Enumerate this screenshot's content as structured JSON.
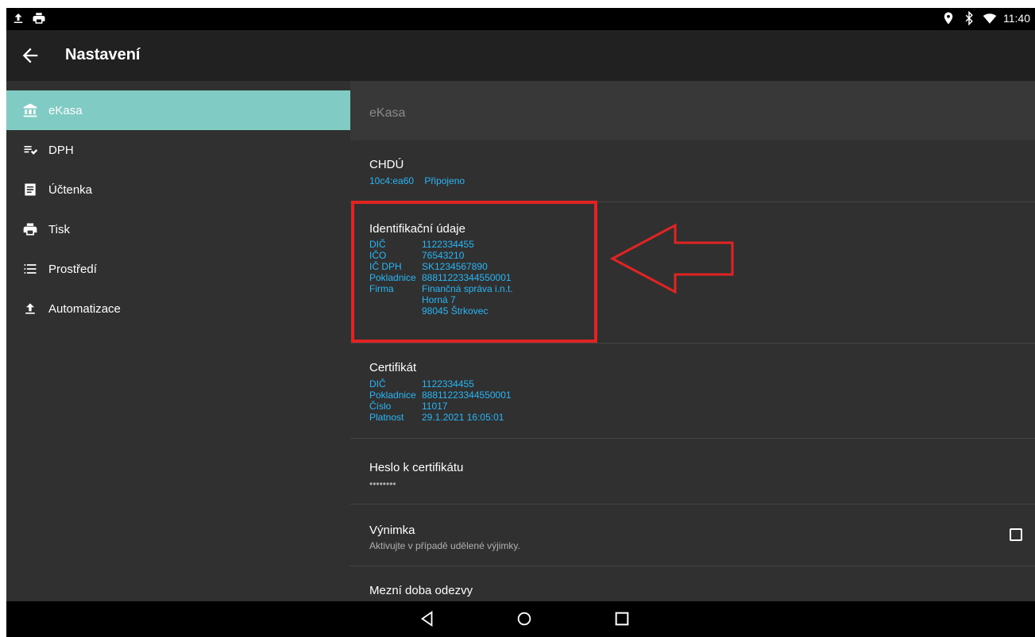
{
  "status_bar": {
    "time": "11:40"
  },
  "toolbar": {
    "title": "Nastavení"
  },
  "sidebar": {
    "items": [
      {
        "label": "eKasa",
        "icon": "bank-icon",
        "active": true
      },
      {
        "label": "DPH",
        "icon": "list-check-icon"
      },
      {
        "label": "Účtenka",
        "icon": "receipt-icon"
      },
      {
        "label": "Tisk",
        "icon": "printer-icon"
      },
      {
        "label": "Prostředí",
        "icon": "list-icon"
      },
      {
        "label": "Automatizace",
        "icon": "upload-icon"
      }
    ]
  },
  "content": {
    "header": "eKasa",
    "chdu": {
      "title": "CHDÚ",
      "address": "10c4:ea60",
      "status": "Připojeno"
    },
    "identification": {
      "title": "Identifikační údaje",
      "rows": [
        {
          "key": "DIČ",
          "value": "1122334455"
        },
        {
          "key": "IČO",
          "value": "76543210"
        },
        {
          "key": "IČ DPH",
          "value": "SK1234567890"
        },
        {
          "key": "Pokladnice",
          "value": "88811223344550001"
        },
        {
          "key": "Firma",
          "value": "Finančná správa i.n.t."
        },
        {
          "key": "",
          "value": "Horná 7"
        },
        {
          "key": "",
          "value": "98045 Štrkovec"
        }
      ]
    },
    "certificate": {
      "title": "Certifikát",
      "rows": [
        {
          "key": "DIČ",
          "value": "1122334455"
        },
        {
          "key": "Pokladnice",
          "value": "88811223344550001"
        },
        {
          "key": "Číslo",
          "value": "11017"
        },
        {
          "key": "Platnost",
          "value": "29.1.2021 16:05:01"
        }
      ]
    },
    "password": {
      "title": "Heslo k certifikátu",
      "value": "••••••••"
    },
    "exception": {
      "title": "Výnimka",
      "subtitle": "Aktivujte v případě udělené výjimky.",
      "checked": false
    },
    "timeout": {
      "title": "Mezní doba odezvy"
    }
  },
  "annotation_color": "#e02424",
  "accent_color": "#80cbc4"
}
